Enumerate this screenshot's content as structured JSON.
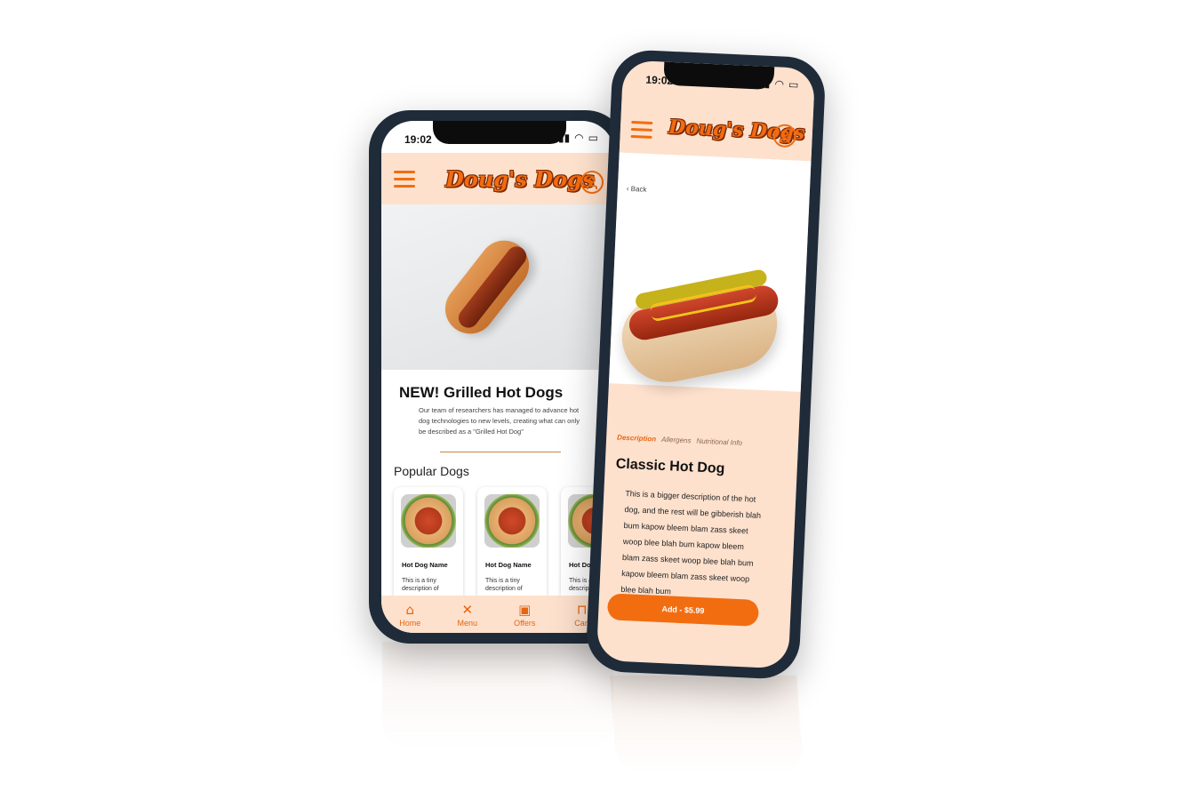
{
  "brand": {
    "logo_text": "Doug's Dogs",
    "accent_color": "#f26d10",
    "bar_color": "#fde1cd"
  },
  "phone_left": {
    "status": {
      "time": "19:02"
    },
    "promo": {
      "title": "NEW! Grilled Hot Dogs",
      "text": "Our team of researchers has managed to advance hot dog technologies to new levels, creating what can only be described as a \"Grilled Hot Dog\""
    },
    "section_title": "Popular Dogs",
    "cards": [
      {
        "name": "Hot Dog Name",
        "desc": "This is a tiny description of"
      },
      {
        "name": "Hot Dog Name",
        "desc": "This is a tiny description of"
      },
      {
        "name": "Hot Dog Name",
        "desc": "This is a tiny description of"
      }
    ],
    "nav": [
      {
        "label": "Home",
        "icon": "home-icon"
      },
      {
        "label": "Menu",
        "icon": "utensils-icon"
      },
      {
        "label": "Offers",
        "icon": "gift-icon"
      },
      {
        "label": "Cart",
        "icon": "bag-icon"
      }
    ]
  },
  "phone_right": {
    "status": {
      "time": "19:02"
    },
    "back_label": "Back",
    "tabs": [
      {
        "label": "Description",
        "active": true
      },
      {
        "label": "Allergens",
        "active": false
      },
      {
        "label": "Nutritional Info",
        "active": false
      }
    ],
    "product_title": "Classic Hot Dog",
    "product_description": "This is a bigger description of the hot dog, and the rest will be gibberish blah bum kapow bleem blam zass skeet woop blee blah bum kapow bleem blam zass skeet woop blee blah bum kapow bleem blam zass skeet woop blee blah bum",
    "add_button": "Add - $5.99"
  }
}
